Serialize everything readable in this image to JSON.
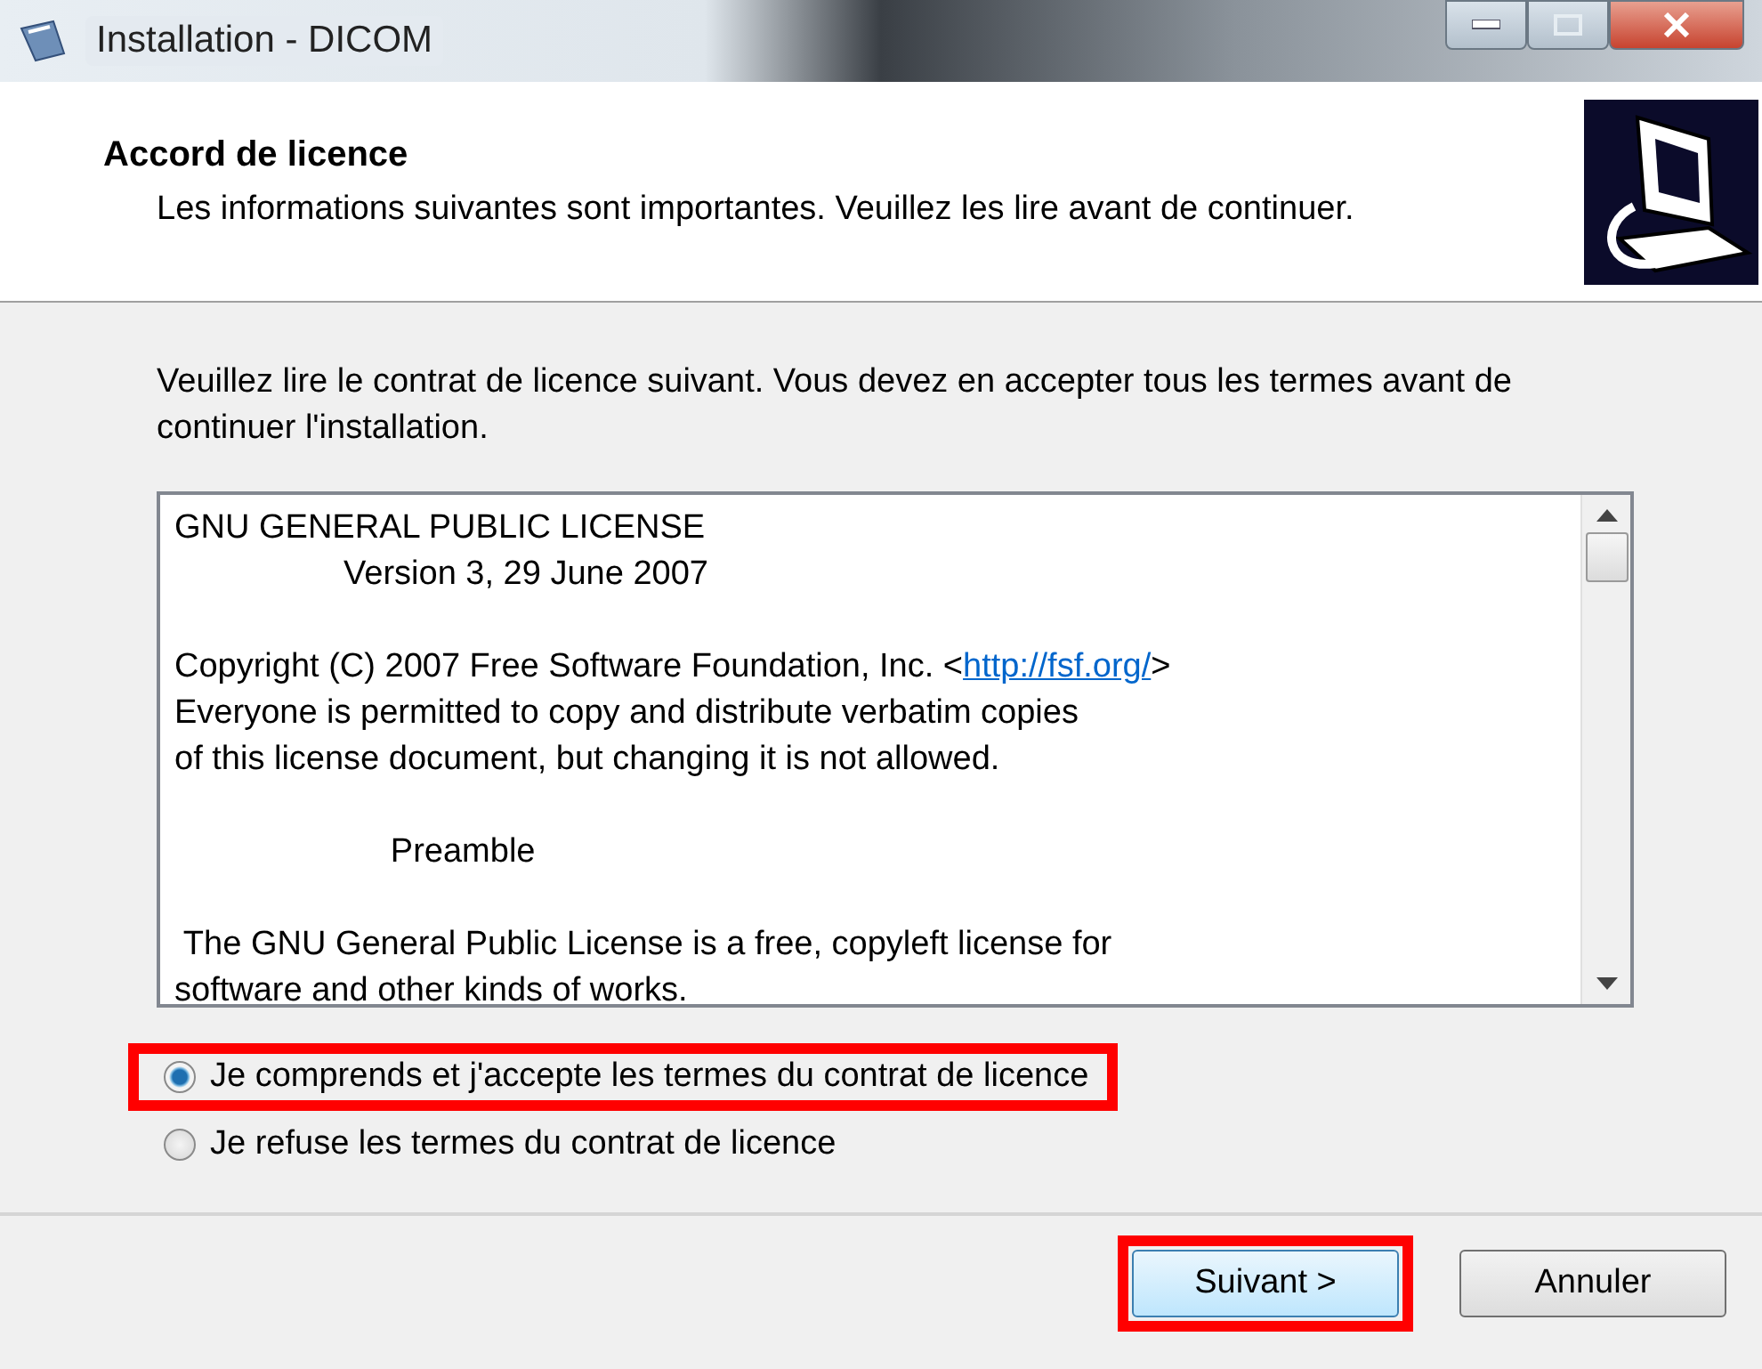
{
  "window": {
    "title": "Installation - DICOM"
  },
  "header": {
    "title": "Accord de licence",
    "subtitle": "Les informations suivantes sont importantes. Veuillez les lire avant de continuer."
  },
  "instructions": "Veuillez lire le contrat de licence suivant. Vous devez en accepter tous les termes avant de continuer l'installation.",
  "license_text": [
    {
      "lines": [
        {
          "text": "GNU GENERAL PUBLIC LICENSE"
        },
        {
          "text": "                  Version 3, 29 June 2007"
        }
      ]
    },
    {
      "lines": [
        {
          "text": "Copyright (C) 2007 Free Software Foundation, Inc. <",
          "link": "http://fsf.org/",
          "after": ">"
        },
        {
          "text": "Everyone is permitted to copy and distribute verbatim copies"
        },
        {
          "text": "of this license document, but changing it is not allowed."
        }
      ]
    },
    {
      "lines": [
        {
          "text": "                       Preamble"
        }
      ]
    },
    {
      "lines": [
        {
          "text": " The GNU General Public License is a free, copyleft license for"
        },
        {
          "text": "software and other kinds of works."
        }
      ]
    }
  ],
  "options": [
    {
      "label": "Je comprends et j'accepte les termes du contrat de licence",
      "selected": true,
      "highlighted": true
    },
    {
      "label": "Je refuse les termes du contrat de licence",
      "selected": false,
      "highlighted": false
    }
  ],
  "buttons": [
    {
      "label": "Suivant >",
      "default": true,
      "highlighted": true
    },
    {
      "label": "Annuler",
      "default": false,
      "highlighted": false
    }
  ]
}
